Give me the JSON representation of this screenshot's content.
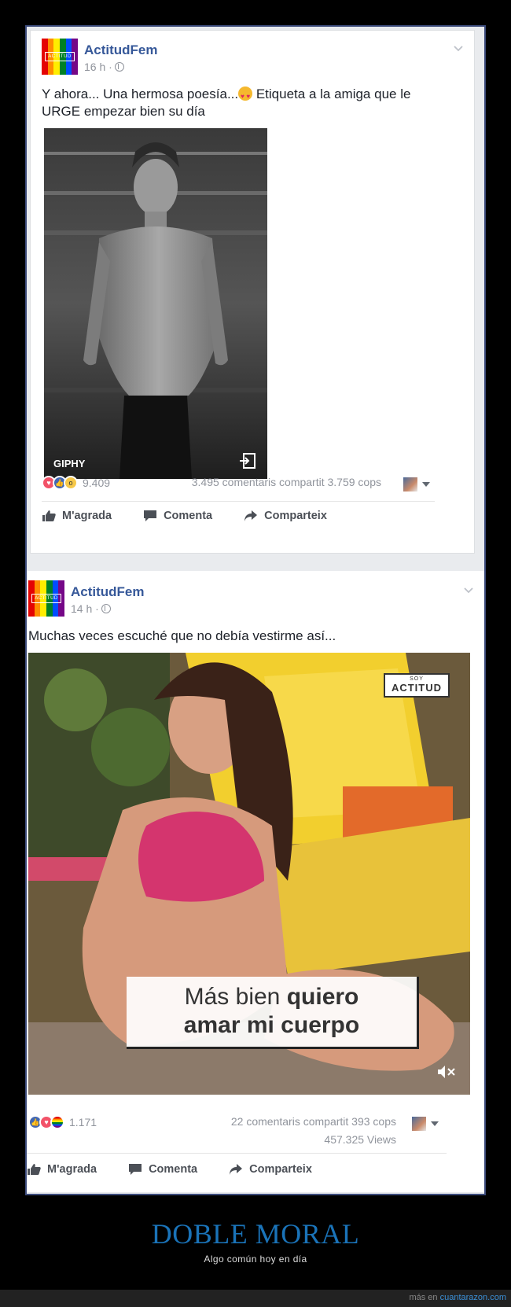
{
  "colors": {
    "link": "#365899",
    "accent": "#1a73b8",
    "frame": "#3b4a7a"
  },
  "logo_stripes": [
    "#e40303",
    "#ff8c00",
    "#ffed00",
    "#008026",
    "#004dff",
    "#750787"
  ],
  "posts": [
    {
      "page_name": "ActitudFem",
      "logo_text": "ACTITUD",
      "time": "16 h ·",
      "message_a": "Y ahora... Una hermosa poesía...",
      "message_b": " Etiqueta a la amiga que le URGE empezar bien su día",
      "gif_label": "GIPHY",
      "reaction_count": "9.409",
      "stats": "3.495 comentaris  compartit 3.759 cops",
      "actions": {
        "like": "M'agrada",
        "comment": "Comenta",
        "share": "Comparteix"
      }
    },
    {
      "page_name": "ActitudFem",
      "logo_text": "ACTITUD",
      "time": "14 h ·",
      "message": "Muchas veces escuché que no debía vestirme así...",
      "video_badge_small": "SOY",
      "video_badge": "ACTITUD",
      "caption_line1_a": "Más bien ",
      "caption_line1_b": "quiero",
      "caption_line2": "amar mi cuerpo",
      "reaction_count": "1.171",
      "stats": "22 comentaris  compartit 393 cops",
      "views": "457.325 Views",
      "actions": {
        "like": "M'agrada",
        "comment": "Comenta",
        "share": "Comparteix"
      }
    }
  ],
  "title": "DOBLE MORAL",
  "subtitle": "Algo común hoy en día",
  "footer": {
    "prefix": "más en ",
    "site": "cuantarazon.com"
  }
}
